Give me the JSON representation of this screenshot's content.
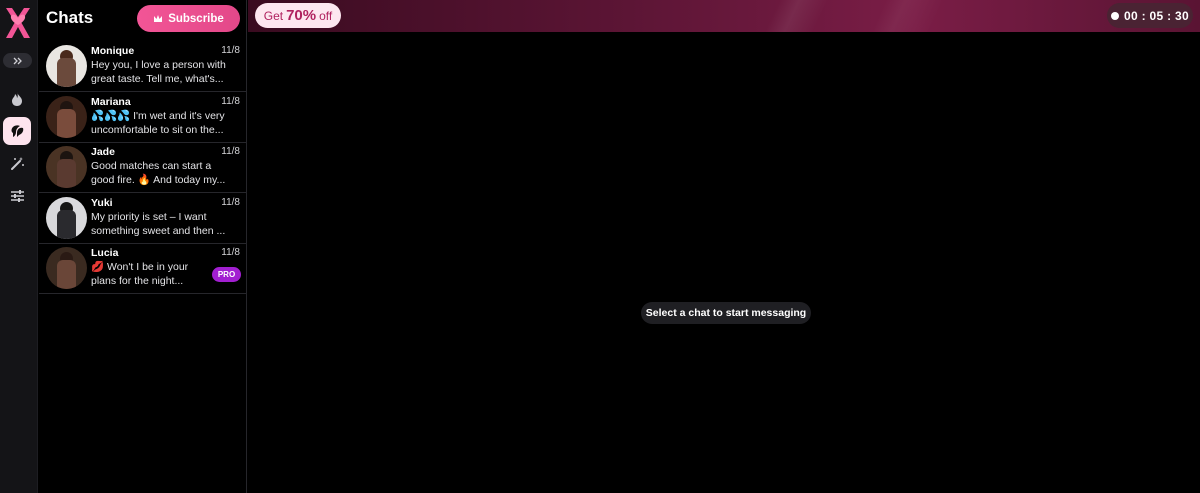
{
  "rail": {
    "icons": [
      "logo-x-icon",
      "expand-icon",
      "flame-icon",
      "chat-bubble-icon",
      "magic-wand-icon",
      "sliders-icon"
    ]
  },
  "chatlist": {
    "title": "Chats",
    "subscribe_label": "Subscribe",
    "items": [
      {
        "name": "Monique",
        "date": "11/8",
        "preview": "Hey you, I love a person with great taste. Tell me, what's...",
        "pro": ""
      },
      {
        "name": "Mariana",
        "date": "11/8",
        "preview": "💦💦💦 I'm wet and it's very uncomfortable to sit on the...",
        "pro": ""
      },
      {
        "name": "Jade",
        "date": "11/8",
        "preview": "Good matches can start a good fire. 🔥 And today my...",
        "pro": ""
      },
      {
        "name": "Yuki",
        "date": "11/8",
        "preview": "My priority is set – I want something sweet and then ...",
        "pro": ""
      },
      {
        "name": "Lucia",
        "date": "11/8",
        "preview": "💋 Won't I be in your plans for the night...",
        "pro": "PRO"
      }
    ]
  },
  "banner": {
    "promo_prefix": "Get",
    "promo_percent": "70%",
    "promo_suffix": "off",
    "timer": "00 : 05 : 30"
  },
  "main": {
    "empty_message": "Select a chat to start messaging"
  },
  "colors": {
    "accent": "#f25596",
    "pro": "#a21fd1",
    "banner": "#7a1d46"
  }
}
